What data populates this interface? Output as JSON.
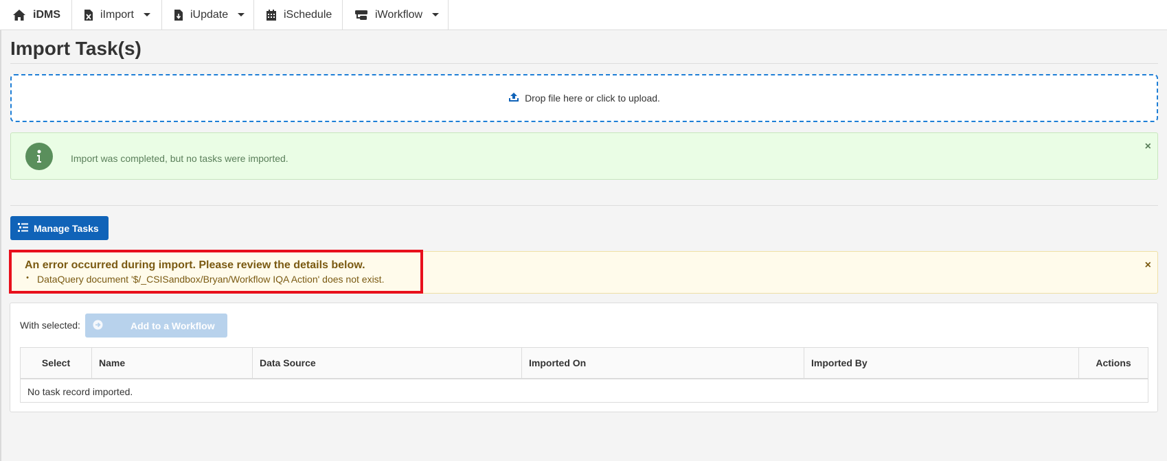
{
  "nav": {
    "items": [
      {
        "label": "iDMS",
        "icon": "home-icon",
        "dropdown": false
      },
      {
        "label": "iImport",
        "icon": "excel-file-icon",
        "dropdown": true
      },
      {
        "label": "iUpdate",
        "icon": "file-download-icon",
        "dropdown": true
      },
      {
        "label": "iSchedule",
        "icon": "calendar-icon",
        "dropdown": false
      },
      {
        "label": "iWorkflow",
        "icon": "workflow-icon",
        "dropdown": true
      }
    ]
  },
  "page": {
    "title": "Import Task(s)"
  },
  "upload": {
    "label": "Drop file here or click to upload.",
    "icon": "upload-icon"
  },
  "success_alert": {
    "message": "Import was completed, but no tasks were imported.",
    "icon": "info-icon",
    "close": "×"
  },
  "manage_tasks": {
    "label": "Manage Tasks",
    "icon": "list-icon"
  },
  "error_alert": {
    "title": "An error occurred during import. Please review the details below.",
    "items": [
      "DataQuery document '$/_CSISandbox/Bryan/Workflow IQA Action' does not exist."
    ],
    "bullet": "•",
    "close": "×"
  },
  "tasks": {
    "with_selected": "With selected:",
    "add_workflow_label": "Add to a Workflow",
    "columns": [
      "Select",
      "Name",
      "Data Source",
      "Imported On",
      "Imported By",
      "Actions"
    ],
    "empty_message": "No task record imported."
  },
  "colors": {
    "primary": "#1063b8",
    "success_bg": "#eafde5",
    "warning_bg": "#fffbeb",
    "highlight": "#e8101c",
    "dropzone_border": "#1e7ed6"
  }
}
